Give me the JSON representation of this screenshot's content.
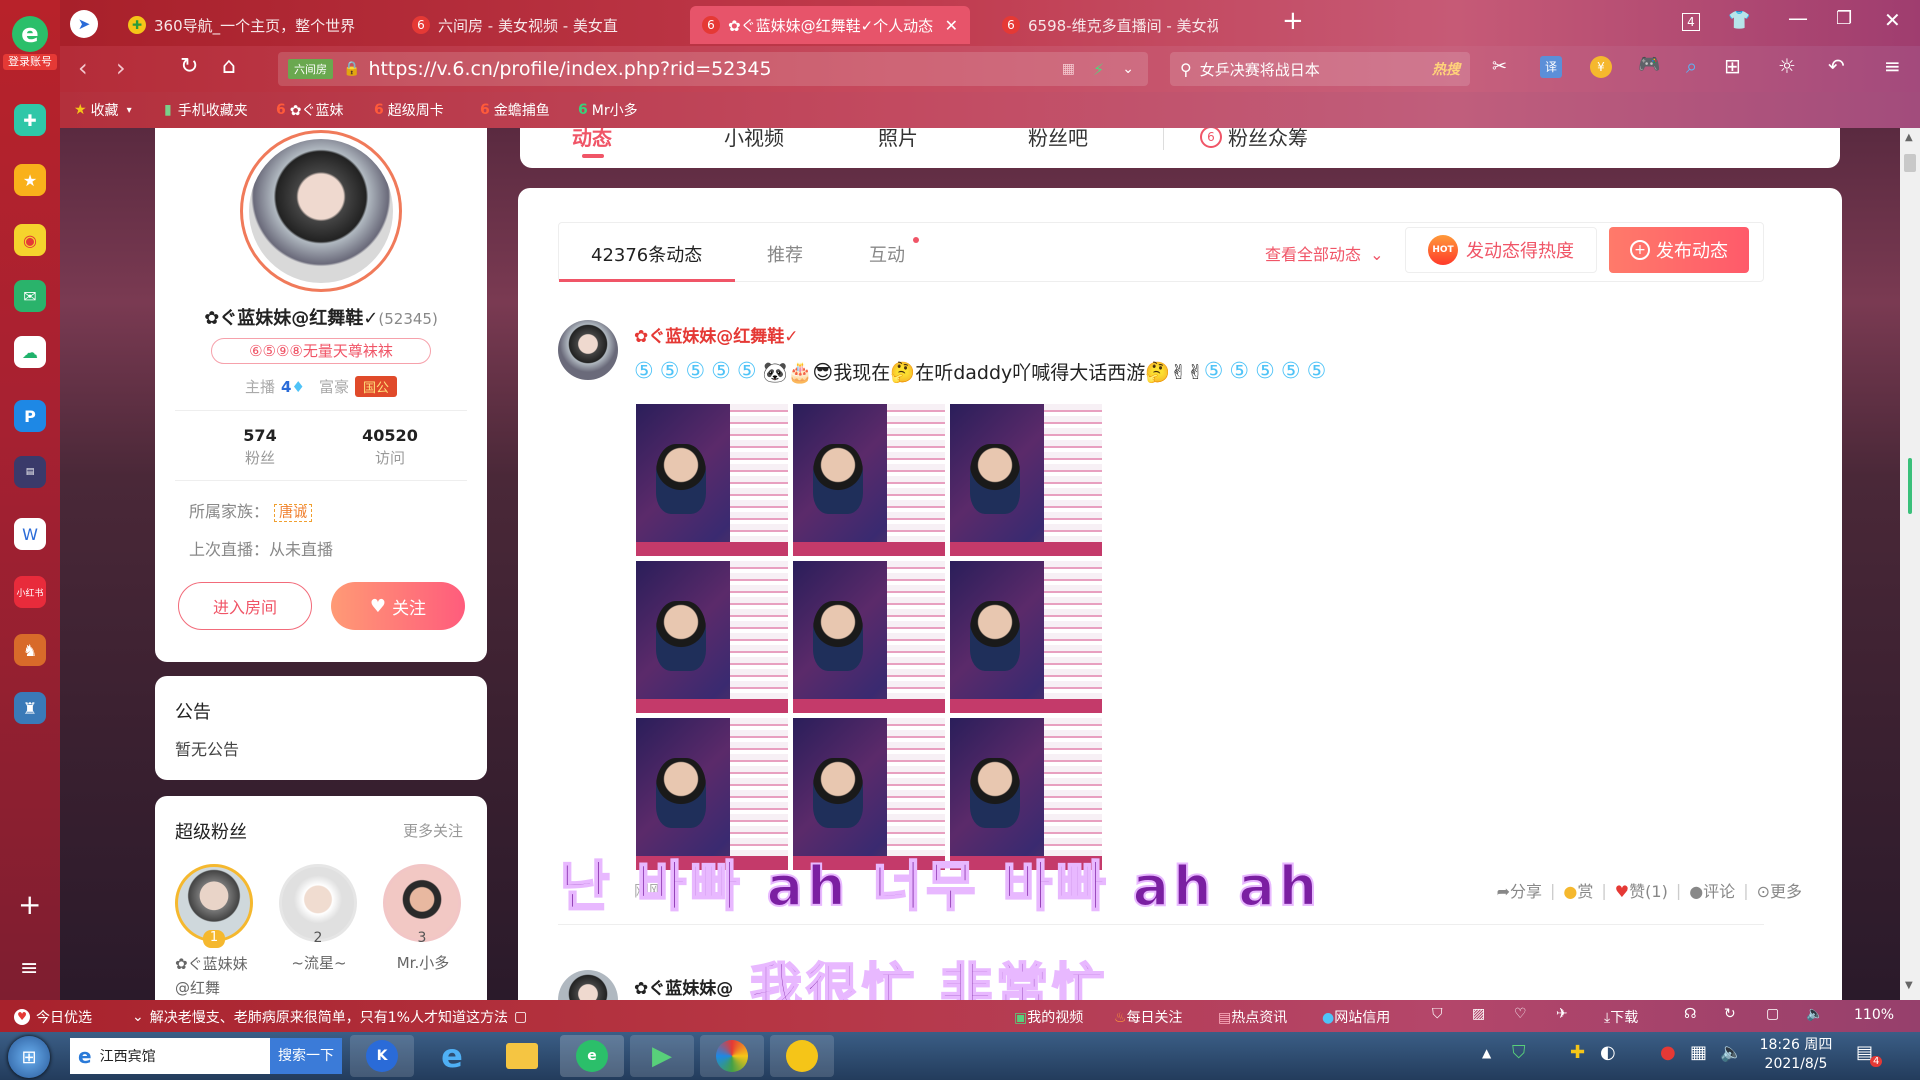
{
  "left_sidebar": {
    "login_label": "登录账号",
    "icons": [
      "plus-cross-icon",
      "star-icon",
      "weibo-icon",
      "mail-icon",
      "cloud-icon",
      "p-app-icon",
      "news-icon",
      "doc-icon",
      "xiaohongshu-icon",
      "game-icon",
      "game2-icon"
    ],
    "xhs_label": "小红书",
    "add_label": "+",
    "menu_label": "≡"
  },
  "tabs": [
    {
      "label": "360导航_一个主页，整个世界",
      "active": false
    },
    {
      "label": "六间房 - 美女视频 - 美女直播",
      "active": false
    },
    {
      "label": "✿ぐ蓝妹妹@红舞鞋✓个人动态",
      "active": true
    },
    {
      "label": "6598-维克多直播间 - 美女视",
      "active": false
    }
  ],
  "tab_add": "+",
  "tab_count": "4",
  "address": {
    "site_badge": "六间房",
    "url": "https://v.6.cn/profile/index.php?rid=52345",
    "search_text": "女乒决赛将战日本",
    "hot_label": "热搜"
  },
  "bookmarks": [
    {
      "label": "收藏",
      "icon": "star-icon"
    },
    {
      "label": "手机收藏夹",
      "icon": "phone-icon"
    },
    {
      "label": "✿ぐ蓝妹",
      "icon": "six-icon"
    },
    {
      "label": "超级周卡",
      "icon": "six-icon"
    },
    {
      "label": "金蟾捕鱼",
      "icon": "six-icon"
    },
    {
      "label": "Mr小多",
      "icon": "six-icon"
    }
  ],
  "profile": {
    "name": "✿ぐ蓝妹妹@红舞鞋✓",
    "rid": "(52345)",
    "badge": "⑥⑤⑨⑧无量天尊袜袜",
    "anchor_label": "主播",
    "anchor_level": "4",
    "rich_label": "富豪",
    "rich_badge": "国公",
    "fans_count": "574",
    "fans_label": "粉丝",
    "visits_count": "40520",
    "visits_label": "访问",
    "family_label": "所属家族：",
    "family_value": "唐诚",
    "last_live": "上次直播：从未直播",
    "enter_room": "进入房间",
    "follow": "关注"
  },
  "notice": {
    "title": "公告",
    "content": "暂无公告"
  },
  "super_fans": {
    "title": "超级粉丝",
    "more": "更多关注",
    "fans": [
      {
        "rank": "1",
        "name": "✿ぐ蓝妹妹@红舞",
        "color": "#f5b82e"
      },
      {
        "rank": "2",
        "name": "~流星~",
        "color": "#c9c9c9"
      },
      {
        "rank": "3",
        "name": "Mr.小多",
        "color": "#e8a080"
      }
    ]
  },
  "top_nav": [
    "动态",
    "小视频",
    "照片",
    "粉丝吧",
    "粉丝众筹"
  ],
  "feed": {
    "tabs": [
      "42376条动态",
      "推荐",
      "互动"
    ],
    "view_all": "查看全部动态",
    "hot_btn": "发动态得热度",
    "hot_icon_label": "HOT",
    "post_btn": "发布动态",
    "post": {
      "author": "✿ぐ蓝妹妹@红舞鞋✓",
      "text_prefix": "我现在",
      "text_mid": "在听daddy吖喊得大话西游",
      "time": "刚刚",
      "share": "分享",
      "reward": "赏",
      "like": "赞(1)",
      "comment": "评论",
      "more": "更多"
    },
    "post2_author": "✿ぐ蓝妹妹@"
  },
  "subtitles": {
    "line1": "난 바빠 ah 너무 바빠 ah ah",
    "line2": "我很忙 非常忙"
  },
  "status_bar": {
    "left_label": "今日优选",
    "news": "解决老慢支、老肺病原来很简单，只有1%人才知道这方法",
    "items": [
      "我的视频",
      "每日关注",
      "热点资讯",
      "网站信用",
      "下载"
    ],
    "zoom": "110%"
  },
  "taskbar": {
    "app_label": "江西宾馆",
    "search_btn": "搜索一下",
    "time": "18:26 周四",
    "date": "2021/8/5",
    "notify_count": "4"
  }
}
